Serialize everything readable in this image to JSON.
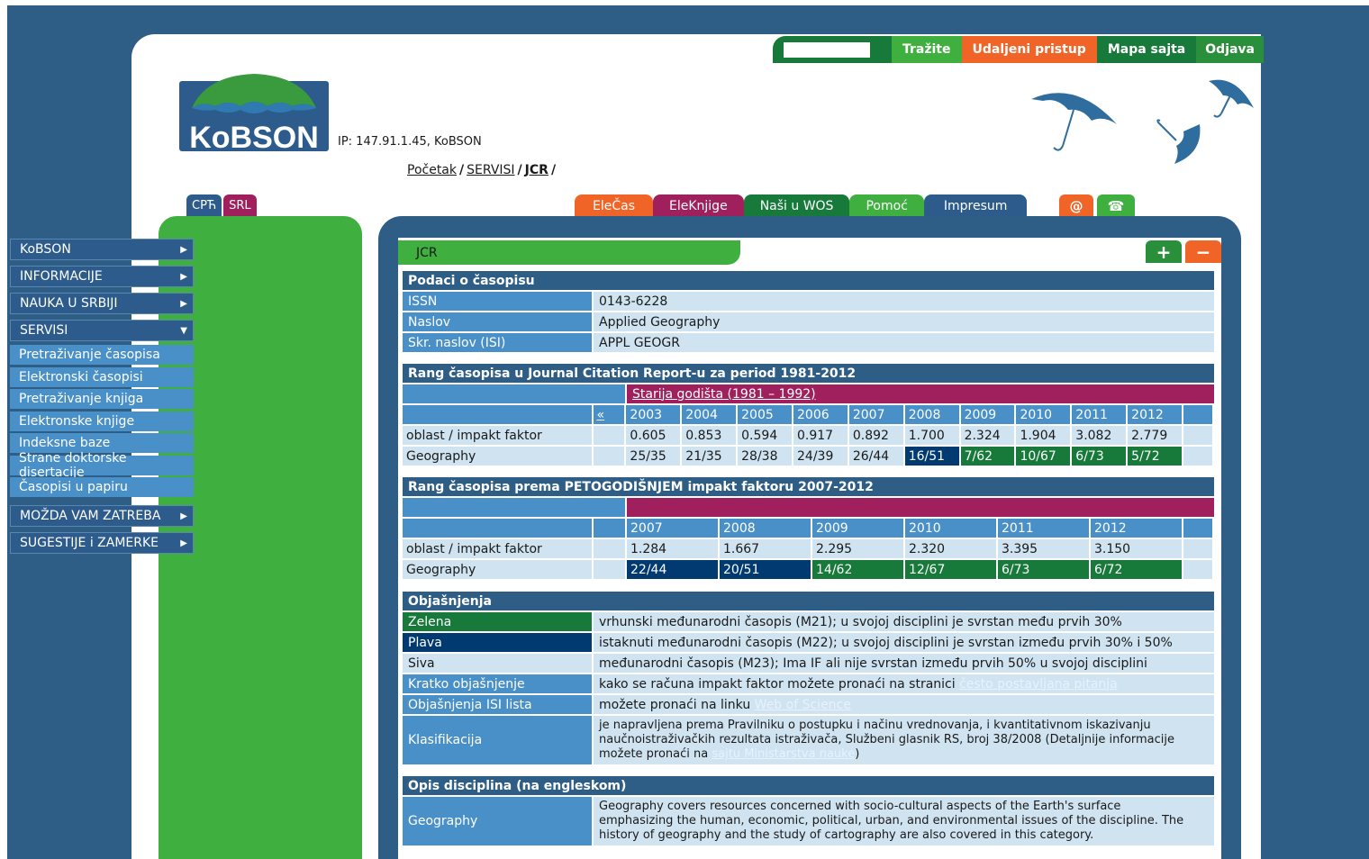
{
  "topbar": {
    "search_value": "",
    "search_button": "Tražite",
    "remote_access": "Udaljeni pristup",
    "sitemap": "Mapa sajta",
    "logout": "Odjava"
  },
  "logo_text": "KoBSON",
  "ip_text": "IP: 147.91.1.45, KoBSON",
  "breadcrumb": {
    "home": "Početak",
    "servisi": "SERVISI",
    "current": "JCR"
  },
  "lang": {
    "cyr": "СРЋ",
    "lat": "SRL"
  },
  "tabs": [
    "EleČas",
    "EleKnjige",
    "Naši u WOS",
    "Pomoć",
    "Impresum"
  ],
  "icon_tabs": {
    "email": "@",
    "phone": "☎"
  },
  "sidebar": {
    "items": [
      "KoBSON",
      "INFORMACIJE",
      "NAUKA U SRBIJI",
      "SERVISI"
    ],
    "sub_items": [
      "Pretraživanje časopisa",
      "Elektronski časopisi",
      "Pretraživanje knjiga",
      "Elektronske knjige",
      "Indeksne baze",
      "Strane doktorske disertacije",
      "Časopisi u papiru"
    ],
    "bottom_items": [
      "MOŽDA VAM ZATREBA",
      "SUGESTIJE i ZAMERKE"
    ]
  },
  "panel": {
    "tab_label": "JCR",
    "plus": "+",
    "minus": "−"
  },
  "journal": {
    "heading": "Podaci o časopisu",
    "rows": [
      {
        "label": "ISSN",
        "value": "0143-6228"
      },
      {
        "label": "Naslov",
        "value": "Applied Geography"
      },
      {
        "label": "Skr. naslov (ISI)",
        "value": "APPL GEOGR"
      }
    ]
  },
  "rank1": {
    "heading": "Rang časopisa u Journal Citation Report-u za period 1981-2012",
    "older_link": "Starija godišta (1981 – 1992)",
    "prev": "«",
    "years": [
      "2003",
      "2004",
      "2005",
      "2006",
      "2007",
      "2008",
      "2009",
      "2010",
      "2011",
      "2012"
    ],
    "row_if_label": "oblast / impakt faktor",
    "if_values": [
      "0.605",
      "0.853",
      "0.594",
      "0.917",
      "0.892",
      "1.700",
      "2.324",
      "1.904",
      "3.082",
      "2.779"
    ],
    "row_rank_label": "Geography",
    "ranks": [
      "25/35",
      "21/35",
      "28/38",
      "24/39",
      "26/44",
      "16/51",
      "7/62",
      "10/67",
      "6/73",
      "5/72"
    ]
  },
  "rank2": {
    "heading": "Rang časopisa prema PETOGODIŠNJEM impakt faktoru 2007-2012",
    "years": [
      "2007",
      "2008",
      "2009",
      "2010",
      "2011",
      "2012"
    ],
    "row_if_label": "oblast / impakt faktor",
    "if_values": [
      "1.284",
      "1.667",
      "2.295",
      "2.320",
      "3.395",
      "3.150"
    ],
    "row_rank_label": "Geography",
    "ranks": [
      "22/44",
      "20/51",
      "14/62",
      "12/67",
      "6/73",
      "6/72"
    ]
  },
  "legend": {
    "heading": "Objašnjenja",
    "zelena": {
      "label": "Zelena",
      "text": "vrhunski međunarodni časopis (M21); u svojoj disciplini je svrstan među prvih 30%"
    },
    "plava": {
      "label": "Plava",
      "text": "istaknuti međunarodni časopis (M22); u svojoj disciplini je svrstan između prvih 30% i 50%"
    },
    "siva": {
      "label": "Siva",
      "text": "međunarodni časopis (M23); Ima IF ali nije svrstan između prvih 50% u svojoj disciplini"
    },
    "kratko": {
      "label": "Kratko objašnjenje",
      "text": "kako se računa impakt faktor možete pronaći na stranici ",
      "link": "često postavljana pitanja"
    },
    "isi": {
      "label": "Objašnjenja ISI lista",
      "text": "možete pronaći na linku ",
      "link": "Web of Science"
    },
    "klas": {
      "label": "Klasifikacija",
      "text": "je napravljena prema Pravilniku o postupku i načinu vrednovanja, i kvantitativnom iskazivanju naučnoistraživačkih rezultata istraživača, Službeni glasnik RS, broj 38/2008 (Detaljnije informacije možete pronaći na ",
      "link": "sajtu Ministarstva nauke",
      "tail": ")"
    }
  },
  "disc": {
    "heading": "Opis disciplina (na engleskom)",
    "label": "Geography",
    "text": "Geography covers resources concerned with socio-cultural aspects of the Earth's surface emphasizing the human, economic, political, urban, and environmental issues of the discipline. The history of geography and the study of cartography are also covered in this category."
  }
}
